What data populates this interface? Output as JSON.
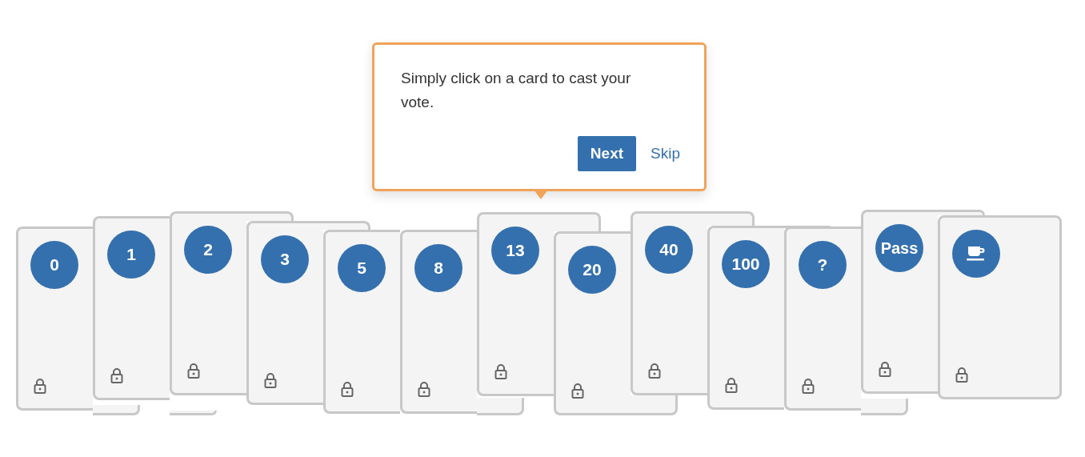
{
  "tour_popup": {
    "message": "Simply click on a card to cast your vote.",
    "next_button": "Next",
    "skip_link": "Skip"
  },
  "cards": [
    {
      "kind": "value",
      "label": "0"
    },
    {
      "kind": "value",
      "label": "1"
    },
    {
      "kind": "value",
      "label": "2"
    },
    {
      "kind": "value",
      "label": "3"
    },
    {
      "kind": "value",
      "label": "5"
    },
    {
      "kind": "value",
      "label": "8"
    },
    {
      "kind": "value",
      "label": "13"
    },
    {
      "kind": "value",
      "label": "20"
    },
    {
      "kind": "value",
      "label": "40"
    },
    {
      "kind": "value",
      "label": "100"
    },
    {
      "kind": "value",
      "label": "?"
    },
    {
      "kind": "value",
      "label": "Pass"
    },
    {
      "kind": "coffee"
    }
  ]
}
